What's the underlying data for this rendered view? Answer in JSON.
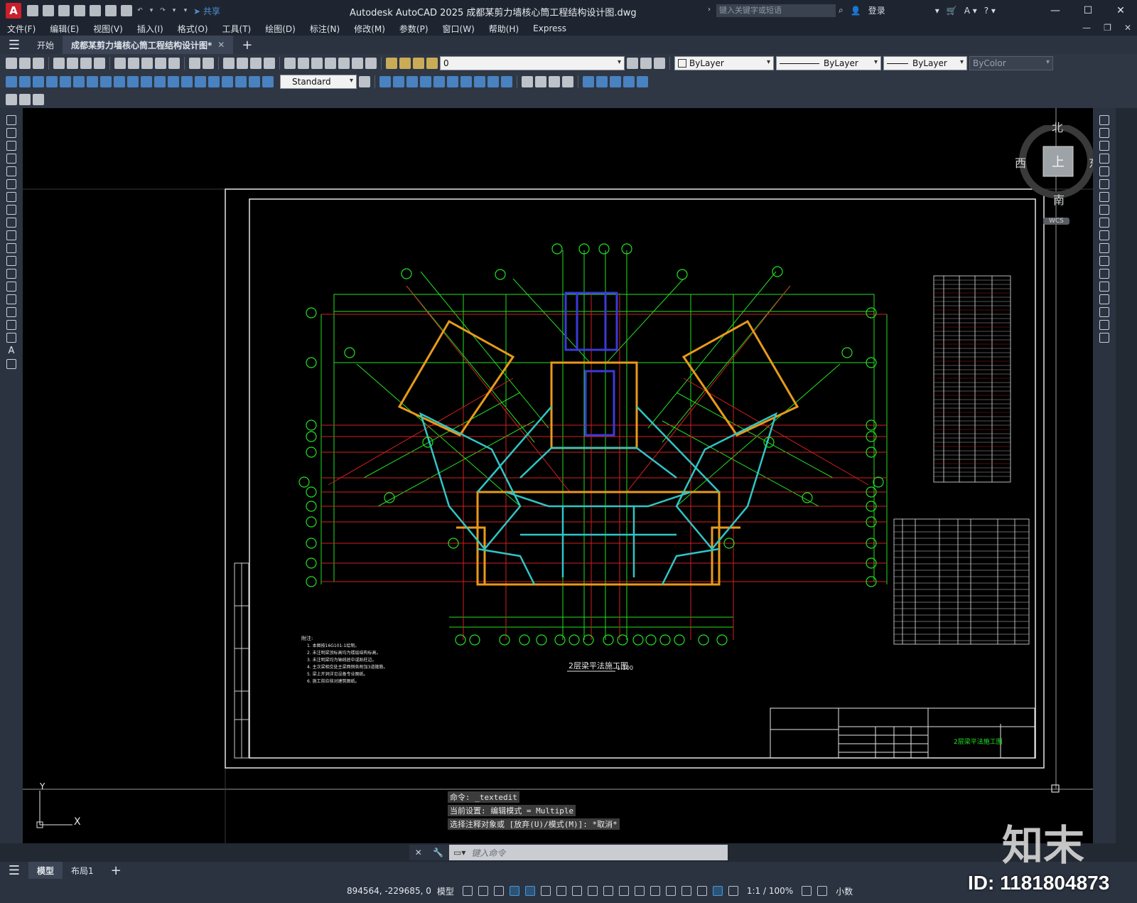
{
  "app": {
    "logo_letter": "A",
    "share_label": "共享",
    "title": "Autodesk AutoCAD 2025    成都某剪力墙核心筒工程结构设计图.dwg",
    "search_placeholder": "键入关键字或短语",
    "login_label": "登录"
  },
  "menu": [
    "文件(F)",
    "编辑(E)",
    "视图(V)",
    "插入(I)",
    "格式(O)",
    "工具(T)",
    "绘图(D)",
    "标注(N)",
    "修改(M)",
    "参数(P)",
    "窗口(W)",
    "帮助(H)",
    "Express"
  ],
  "tabs": {
    "start": "开始",
    "active": "成都某剪力墙核心筒工程结构设计图*"
  },
  "toolbar": {
    "layer_value": "0",
    "color_value": "ByLayer",
    "linetype_value": "ByLayer",
    "lineweight_value": "ByLayer",
    "plotstyle_value": "ByColor",
    "textstyle_value": "Standard"
  },
  "viewcube": {
    "north": "北",
    "south": "南",
    "east": "东",
    "west": "西",
    "face": "上",
    "wcs": "WCS"
  },
  "drawing": {
    "plan_title": "2层梁平法施工图",
    "plan_scale": "1:100",
    "notes_title": "附注:",
    "notes": [
      "1. 本图按16G101-1绘制。",
      "2. 未注明梁顶标高均为楼层结构标高。",
      "3. 未注明梁均为轴线居中或贴柱边。",
      "4. 主次梁相交处主梁两侧各附加3道箍筋。",
      "5. 梁上开洞详见设备专业图纸。",
      "6. 施工前应核对建筑图纸。"
    ],
    "titleblock_drawing_name": "2层梁平法施工图",
    "axis_ucs_y": "Y",
    "axis_ucs_x": "X"
  },
  "command": {
    "history": [
      "命令: _textedit",
      "当前设置: 编辑模式 = Multiple",
      "选择注释对象或 [放弃(U)/模式(M)]: *取消*"
    ],
    "placeholder": "键入命令"
  },
  "layouts": {
    "model": "模型",
    "layout1": "布局1"
  },
  "status": {
    "coords": "894564, -229685, 0",
    "mode": "模型",
    "scale": "1:1 / 100%",
    "units": "小数"
  },
  "watermark": {
    "logo": "知末",
    "id": "ID: 1181804873"
  },
  "colors": {
    "axis_red": "#d21f1f",
    "grid_green": "#22e022",
    "wall_orange": "#e89a1a",
    "beam_cyan": "#2fc6c6",
    "column_blue": "#3a3ad8"
  }
}
